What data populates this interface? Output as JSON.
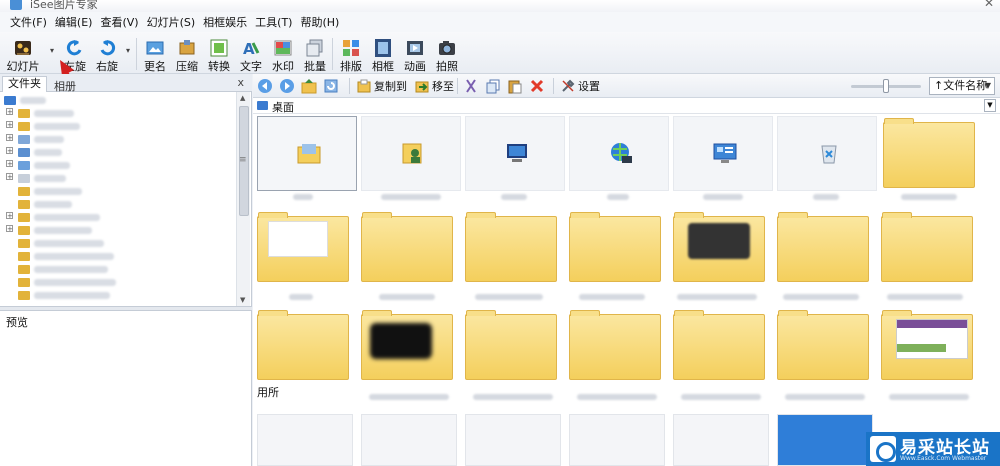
{
  "window": {
    "title": "iSee图片专家"
  },
  "menu": [
    {
      "label": "文件(F)"
    },
    {
      "label": "编辑(E)"
    },
    {
      "label": "查看(V)"
    },
    {
      "label": "幻灯片(S)"
    },
    {
      "label": "相框娱乐"
    },
    {
      "label": "工具(T)"
    },
    {
      "label": "帮助(H)"
    }
  ],
  "toolbar": [
    {
      "label": "幻灯片",
      "icon": "film-icon"
    },
    {
      "label": "左旋",
      "icon": "rotate-left-icon"
    },
    {
      "label": "右旋",
      "icon": "rotate-right-icon"
    },
    {
      "label": "更名",
      "icon": "rename-icon"
    },
    {
      "label": "压缩",
      "icon": "compress-icon"
    },
    {
      "label": "转换",
      "icon": "convert-icon"
    },
    {
      "label": "文字",
      "icon": "text-icon"
    },
    {
      "label": "水印",
      "icon": "watermark-icon"
    },
    {
      "label": "批量",
      "icon": "batch-icon"
    },
    {
      "label": "排版",
      "icon": "layout-icon"
    },
    {
      "label": "相框",
      "icon": "frame-icon"
    },
    {
      "label": "动画",
      "icon": "animation-icon"
    },
    {
      "label": "拍照",
      "icon": "camera-icon"
    }
  ],
  "left_pane": {
    "tab_label": "文件夹",
    "tab2_label": "相册",
    "close_label": "x",
    "preview_label": "预览"
  },
  "nav_toolbar": {
    "copy_label": "复制到",
    "move_label": "移至",
    "settings_label": "设置",
    "sort_label": "↑文件名称"
  },
  "path": {
    "current": "桌面"
  },
  "grid": {
    "row_label": "用所"
  },
  "watermark": {
    "text": "易采站长站",
    "subtext": "Www.Easck.Com Webmaster"
  },
  "colors": {
    "folder_fill": "#f4cf5c",
    "accent_blue": "#1a74c7",
    "annotation_red": "#d32020"
  }
}
